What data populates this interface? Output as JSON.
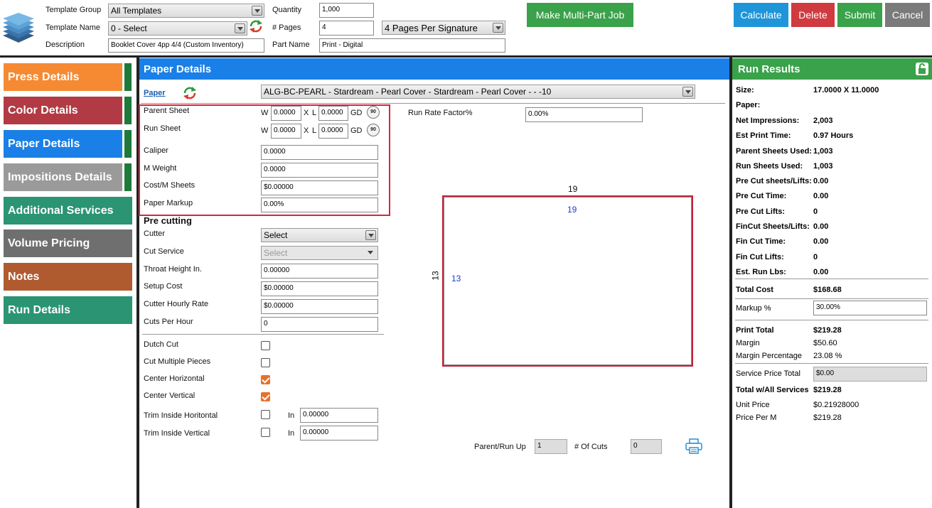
{
  "header": {
    "template_group_label": "Template Group",
    "template_group_value": "All Templates",
    "template_name_label": "Template Name",
    "template_name_value": "0 - Select",
    "description_label": "Description",
    "description_value": "Booklet Cover 4pp 4/4 (Custom Inventory)",
    "quantity_label": "Quantity",
    "quantity_value": "1,000",
    "pages_label": "# Pages",
    "pages_value": "4",
    "pages_per_signature": "4 Pages Per Signature",
    "part_name_label": "Part Name",
    "part_name_value": "Print - Digital",
    "multi_part_button": "Make Multi-Part Job",
    "calculate_button": "Calculate",
    "delete_button": "Delete",
    "submit_button": "Submit",
    "cancel_button": "Cancel"
  },
  "sidebar": {
    "items": [
      {
        "label": "Press Details",
        "color": "#f58a33"
      },
      {
        "label": "Color Details",
        "color": "#b23a44"
      },
      {
        "label": "Paper Details",
        "color": "#1a7fe6"
      },
      {
        "label": "Impositions Details",
        "color": "#9a9a9a"
      },
      {
        "label": "Additional Services",
        "color": "#2a9473"
      },
      {
        "label": "Volume Pricing",
        "color": "#6f6f6f"
      },
      {
        "label": "Notes",
        "color": "#b05a30"
      },
      {
        "label": "Run Details",
        "color": "#2a9473"
      }
    ]
  },
  "paper": {
    "section_title": "Paper Details",
    "paper_link": "Paper",
    "paper_select": "ALG-BC-PEARL - Stardream - Pearl Cover - Stardream - Pearl Cover -  - -10",
    "parent_sheet_label": "Parent Sheet",
    "run_sheet_label": "Run Sheet",
    "w_label": "W",
    "x_label": "X",
    "l_label": "L",
    "gd_label": "GD",
    "rotate_label": "90",
    "parent_w": "0.0000",
    "parent_l": "0.0000",
    "run_w": "0.0000",
    "run_l": "0.0000",
    "run_rate_label": "Run Rate Factor%",
    "run_rate_value": "0.00%",
    "caliper_label": "Caliper",
    "caliper_value": "0.0000",
    "mweight_label": "M Weight",
    "mweight_value": "0.0000",
    "cost_label": "Cost/M Sheets",
    "cost_value": "$0.00000",
    "markup_label": "Paper Markup",
    "markup_value": "0.00%"
  },
  "precut": {
    "title": "Pre cutting",
    "cutter_label": "Cutter",
    "cutter_value": "Select",
    "cut_service_label": "Cut Service",
    "cut_service_value": "Select",
    "throat_label": "Throat Height In.",
    "throat_value": "0.00000",
    "setup_label": "Setup Cost",
    "setup_value": "$0.00000",
    "hourly_label": "Cutter Hourly Rate",
    "hourly_value": "$0.00000",
    "cuts_label": "Cuts Per Hour",
    "cuts_value": "0",
    "dutch_label": "Dutch Cut",
    "multi_label": "Cut Multiple Pieces",
    "center_h_label": "Center Horizontal",
    "center_v_label": "Center Vertical",
    "trim_h_label": "Trim Inside Horitontal",
    "trim_v_label": "Trim Inside Vertical",
    "in_label": "In",
    "trim_h_value": "0.00000",
    "trim_v_value": "0.00000"
  },
  "layout": {
    "top_dim": "19",
    "inner_top_dim": "19",
    "side_dim": "13",
    "inner_side_dim": "13",
    "parent_run_label": "Parent/Run Up",
    "parent_run_value": "1",
    "cuts_label": "# Of Cuts",
    "cuts_value": "0"
  },
  "results": {
    "title": "Run Results",
    "rows": [
      {
        "label": "Size:",
        "value": "17.0000 X 11.0000"
      },
      {
        "label": "Paper:",
        "value": ""
      },
      {
        "label": "Net Impressions:",
        "value": "2,003"
      },
      {
        "label": "Est Print Time:",
        "value": "0.97 Hours"
      },
      {
        "label": "Parent Sheets Used:",
        "value": "1,003"
      },
      {
        "label": "Run Sheets Used:",
        "value": "1,003"
      },
      {
        "label": "Pre Cut sheets/Lifts:",
        "value": "0.00"
      },
      {
        "label": "Pre Cut Time:",
        "value": "0.00"
      },
      {
        "label": "Pre Cut Lifts:",
        "value": "0"
      },
      {
        "label": "FinCut Sheets/Lifts:",
        "value": "0.00"
      },
      {
        "label": "Fin Cut Time:",
        "value": "0.00"
      },
      {
        "label": "Fin Cut Lifts:",
        "value": "0"
      },
      {
        "label": "Est. Run Lbs:",
        "value": "0.00"
      }
    ],
    "total_cost_label": "Total Cost",
    "total_cost_value": "$168.68",
    "markup_label": "Markup %",
    "markup_value": "30.00%",
    "print_total_label": "Print Total",
    "print_total_value": "$219.28",
    "margin_label": "Margin",
    "margin_value": "$50.60",
    "margin_pct_label": "Margin Percentage",
    "margin_pct_value": "23.08 %",
    "service_label": "Service Price Total",
    "service_value": "$0.00",
    "total_all_label": "Total w/All Services",
    "total_all_value": "$219.28",
    "unit_label": "Unit Price",
    "unit_value": "$0.21928000",
    "per_m_label": "Price Per M",
    "per_m_value": "$219.28"
  }
}
